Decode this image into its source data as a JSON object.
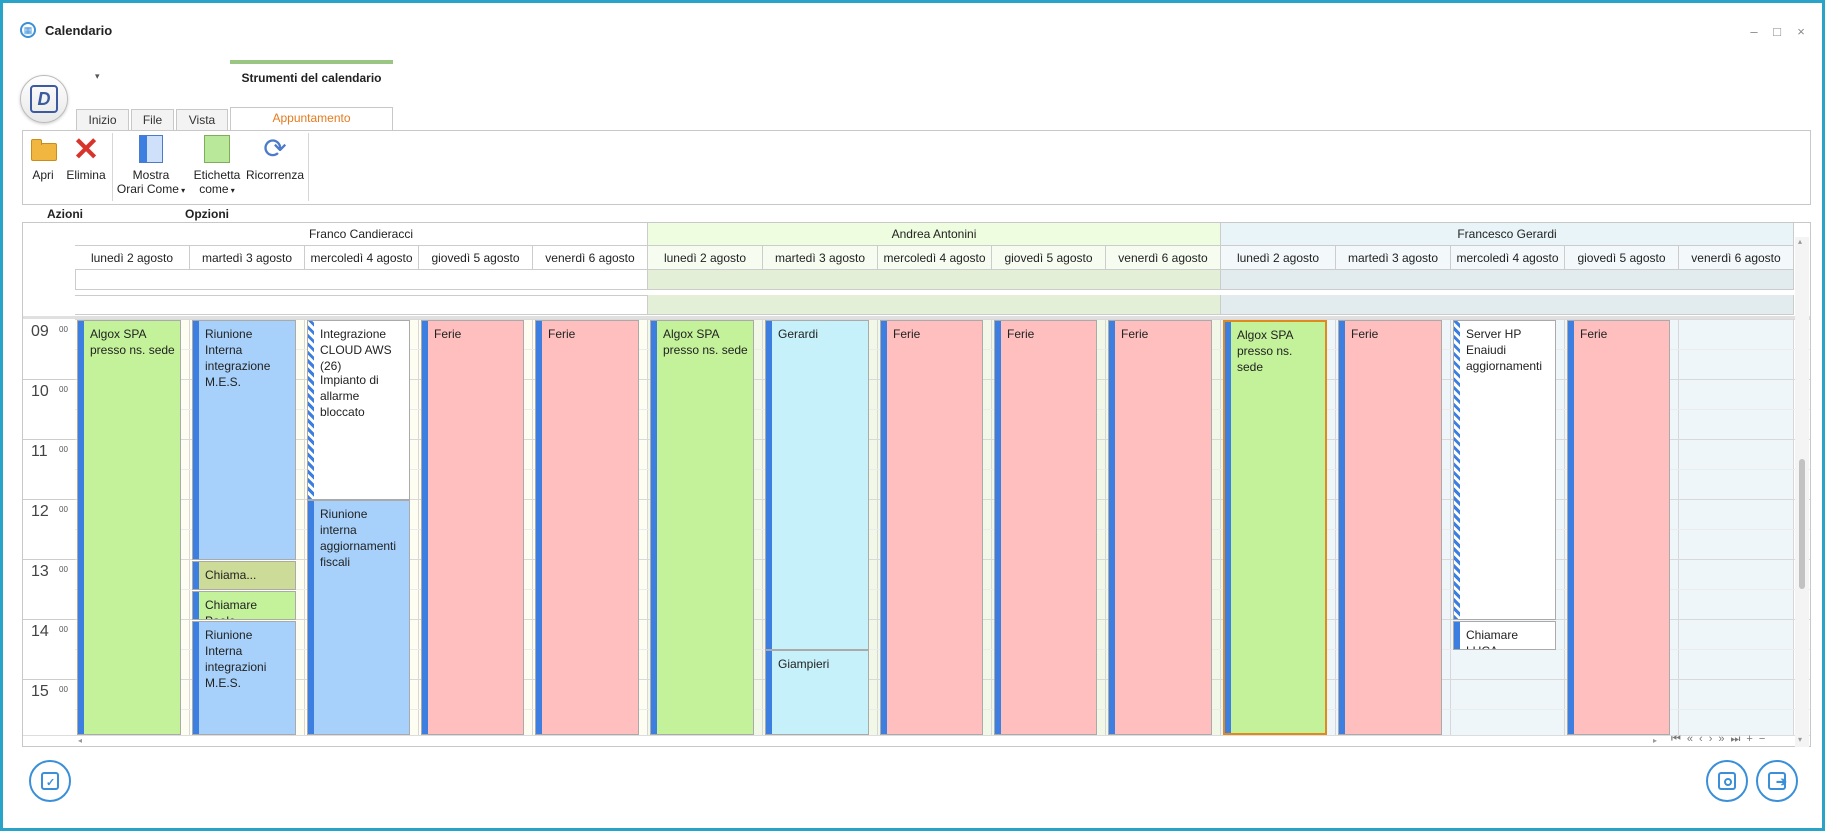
{
  "window": {
    "title": "Calendario",
    "minimize": "–",
    "maximize": "□",
    "close": "×"
  },
  "ribbon": {
    "context_tab": "Strumenti del calendario",
    "tabs": [
      "Inizio",
      "File",
      "Vista",
      "Appuntamento"
    ],
    "active_tab": "Appuntamento",
    "buttons": {
      "apri": "Apri",
      "elimina": "Elimina",
      "mostra_line1": "Mostra",
      "mostra_line2": "Orari Come",
      "etichetta_line1": "Etichetta",
      "etichetta_line2": "come",
      "ricorrenza": "Ricorrenza"
    },
    "groups": {
      "azioni": "Azioni",
      "opzioni": "Opzioni"
    }
  },
  "scheduler": {
    "resources": [
      {
        "name": "Franco Candieracci",
        "header_color": "#ffffff"
      },
      {
        "name": "Andrea Antonini",
        "header_color": "#eefcdf"
      },
      {
        "name": "Francesco Gerardi",
        "header_color": "#e8f4f8"
      }
    ],
    "days": [
      "lunedì 2 agosto",
      "martedì 3 agosto",
      "mercoledì 4 agosto",
      "giovedì 5 agosto",
      "venerdì 6 agosto"
    ],
    "hours": [
      "09",
      "10",
      "11",
      "12",
      "13",
      "14",
      "15"
    ],
    "minutes_label": "00",
    "appointments": {
      "fc_mon": "Algox SPA presso ns. sede",
      "fc_tue_1": "Riunione Interna integrazione M.E.S.",
      "fc_tue_2": "Chiama...",
      "fc_tue_3": "Chiamare Paolo",
      "fc_tue_4": "Riunione Interna integrazioni M.E.S.",
      "fc_wed_1a": "Integrazione CLOUD AWS (26)",
      "fc_wed_1b": "Impianto di allarme bloccato",
      "fc_wed_2": "Riunione interna aggiornamenti fiscali",
      "fc_thu": "Ferie",
      "fc_fri": "Ferie",
      "aa_mon": "Algox SPA presso ns. sede",
      "aa_tue_1": "Gerardi",
      "aa_tue_2": "Giampieri",
      "aa_wed": "Ferie",
      "aa_thu": "Ferie",
      "aa_fri": "Ferie",
      "fg_mon": "Algox SPA presso ns. sede",
      "fg_tue": "Ferie",
      "fg_wed_1": "Server HP Enaiudi aggiornamenti",
      "fg_wed_2": "Chiamare LUCA",
      "fg_thu": "Ferie"
    }
  },
  "colors": {
    "accent": "#2aa3c8",
    "active_tab": "#e47b1f",
    "appt_green": "#c3f29b",
    "appt_blue": "#a7d1fb",
    "appt_red": "#ffbfbf",
    "appt_cyan": "#c7f1fa",
    "status_bar": "#3d7fe0"
  }
}
